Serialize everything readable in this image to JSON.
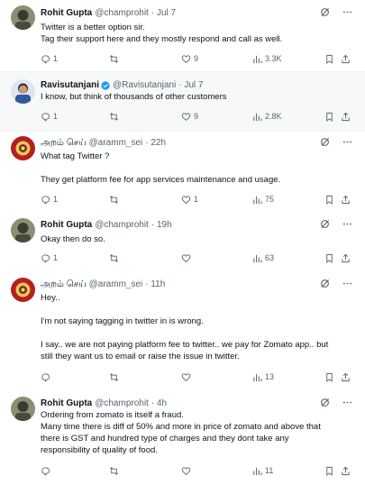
{
  "tweets": [
    {
      "name": "Rohit Gupta",
      "handle": "@champrohit",
      "time": "· Jul 7",
      "verified": false,
      "lines": [
        "Twitter is a better option sir.",
        "Tag their support here and they mostly respond and call as well."
      ],
      "stats": {
        "replies": "1",
        "retweets": "",
        "likes": "9",
        "views": "3.3K"
      }
    },
    {
      "name": "Ravisutanjani",
      "handle": "@Ravisutanjani",
      "time": "· Jul 7",
      "verified": true,
      "lines": [
        "I know, but think of thousands of other customers"
      ],
      "stats": {
        "replies": "1",
        "retweets": "",
        "likes": "9",
        "views": "2.8K"
      }
    },
    {
      "name": "அறம் செய்",
      "handle": "@aramm_sei",
      "time": "· 22h",
      "verified": false,
      "lines": [
        "What tag Twitter ?",
        "",
        "They get platform fee for app services maintenance and usage."
      ],
      "stats": {
        "replies": "1",
        "retweets": "",
        "likes": "1",
        "views": "75"
      }
    },
    {
      "name": "Rohit Gupta",
      "handle": "@champrohit",
      "time": "· 19h",
      "verified": false,
      "lines": [
        "Okay then do so."
      ],
      "stats": {
        "replies": "1",
        "retweets": "",
        "likes": "",
        "views": "63"
      }
    },
    {
      "name": "அறம் செய்",
      "handle": "@aramm_sei",
      "time": "· 11h",
      "verified": false,
      "lines": [
        "Hey..",
        "",
        "I'm not saying tagging in twitter in is wrong.",
        "",
        "I say.. we are not paying platform fee to twitter.. we pay for Zomato app.. but",
        "still they want us to email or raise the issue in twitter."
      ],
      "stats": {
        "replies": "",
        "retweets": "",
        "likes": "",
        "views": "13"
      }
    },
    {
      "name": "Rohit Gupta",
      "handle": "@champrohit",
      "time": "· 4h",
      "verified": false,
      "lines": [
        "Ordering from zomato is itself a fraud.",
        "Many time there is diff of 50% and more in price of zomato and above that",
        "there is GST and hundred type of charges and they dont take any",
        "responsibility of quality of food."
      ],
      "stats": {
        "replies": "",
        "retweets": "",
        "likes": "",
        "views": "11"
      }
    }
  ],
  "icons": {
    "reply": "reply-icon",
    "retweet": "retweet-icon",
    "like": "heart-icon",
    "views": "views-icon",
    "bookmark": "bookmark-icon",
    "share": "share-icon",
    "grok": "grok-icon",
    "more": "more-icon"
  },
  "colors": {
    "text": "#0f1419",
    "muted": "#536471",
    "verified": "#1d9bf0",
    "highlight_bg": "#f7f9f9"
  }
}
